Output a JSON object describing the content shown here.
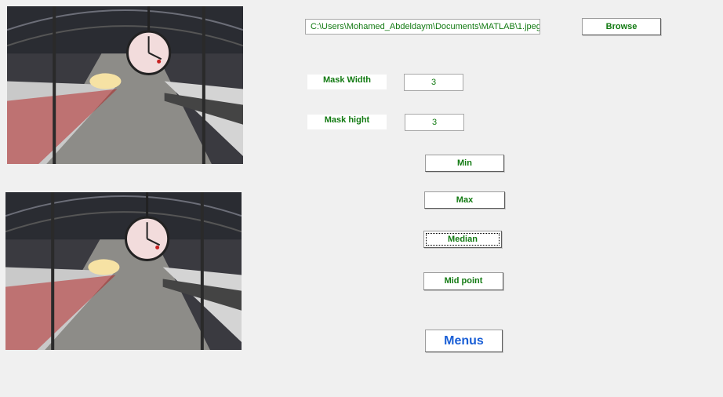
{
  "image_panels": [
    {
      "name": "original-image",
      "description": "train station with clock"
    },
    {
      "name": "filtered-image",
      "description": "train station with clock"
    }
  ],
  "path_field": {
    "value": "C:\\Users\\Mohamed_Abdeldaym\\Documents\\MATLAB\\1.jpeg"
  },
  "browse_button": {
    "label": "Browse"
  },
  "mask_width": {
    "label": "Mask Width",
    "value": "3"
  },
  "mask_height": {
    "label": "Mask hight",
    "value": "3"
  },
  "filters": {
    "min_label": "Min",
    "max_label": "Max",
    "median_label": "Median",
    "midpoint_label": "Mid point"
  },
  "menus_button": {
    "label": "Menus"
  },
  "colors": {
    "label_text": "#127a12",
    "menus_text": "#1a5fd6",
    "background": "#f0f0f0"
  }
}
